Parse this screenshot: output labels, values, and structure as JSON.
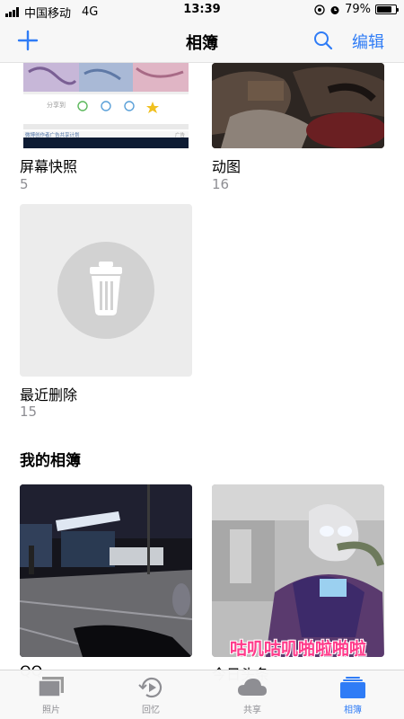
{
  "status_bar": {
    "carrier": "中国移动",
    "network": "4G",
    "time": "13:39",
    "battery": "79%",
    "battery_fraction": 0.79
  },
  "nav": {
    "title": "相簿",
    "edit_label": "编辑",
    "add_icon": "plus-icon",
    "search_icon": "search-icon"
  },
  "albums_top": [
    {
      "title": "屏幕快照",
      "count": "5",
      "thumb_text_share": "分享到",
      "thumb_text_ad": "微博创作者广告共享计划",
      "thumb_text_ad_tag": "广告"
    },
    {
      "title": "动图",
      "count": "16"
    },
    {
      "title": "最近删除",
      "count": "15",
      "icon": "trash-icon"
    }
  ],
  "my_albums": {
    "title": "我的相簿",
    "items": [
      {
        "title": "QQ"
      },
      {
        "title": "今日头条",
        "overlay_text": "咕叽咕叽啪啦啪啦"
      }
    ]
  },
  "tabs": [
    {
      "label": "照片",
      "icon": "photos-icon",
      "active": false
    },
    {
      "label": "回忆",
      "icon": "memories-icon",
      "active": false
    },
    {
      "label": "共享",
      "icon": "cloud-icon",
      "active": false
    },
    {
      "label": "相簿",
      "icon": "albums-icon",
      "active": true
    }
  ],
  "colors": {
    "accent": "#2f7cf6",
    "secondary_text": "#8e8e93",
    "placeholder_bg": "#ececec",
    "placeholder_circle": "#d2d2d2"
  }
}
